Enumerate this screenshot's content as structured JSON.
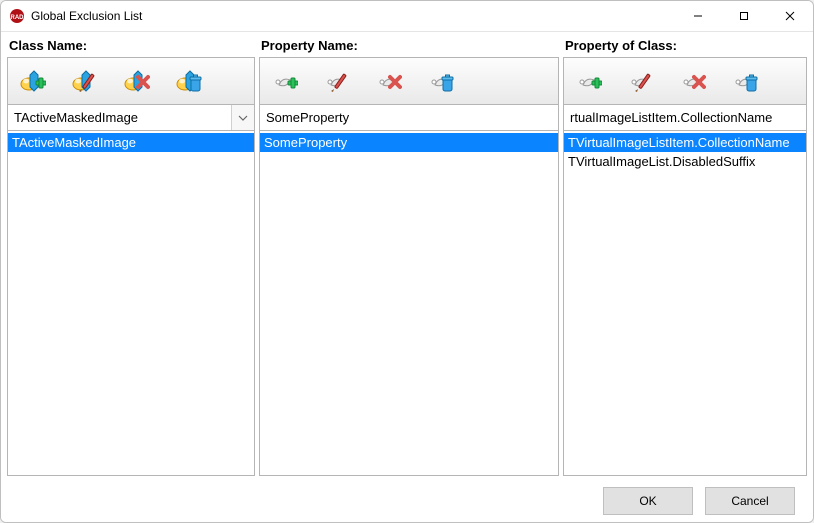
{
  "window": {
    "title": "Global Exclusion List"
  },
  "panels": {
    "class": {
      "header": "Class Name:",
      "input_value": "TActiveMaskedImage",
      "items": [
        "TActiveMaskedImage"
      ],
      "selected_index": 0
    },
    "property": {
      "header": "Property Name:",
      "input_value": "SomeProperty",
      "items": [
        "SomeProperty"
      ],
      "selected_index": 0
    },
    "property_of_class": {
      "header": "Property of Class:",
      "input_value": "rtualImageListItem.CollectionName",
      "items": [
        "TVirtualImageListItem.CollectionName",
        "TVirtualImageList.DisabledSuffix"
      ],
      "selected_index": 0
    }
  },
  "footer": {
    "ok": "OK",
    "cancel": "Cancel"
  }
}
